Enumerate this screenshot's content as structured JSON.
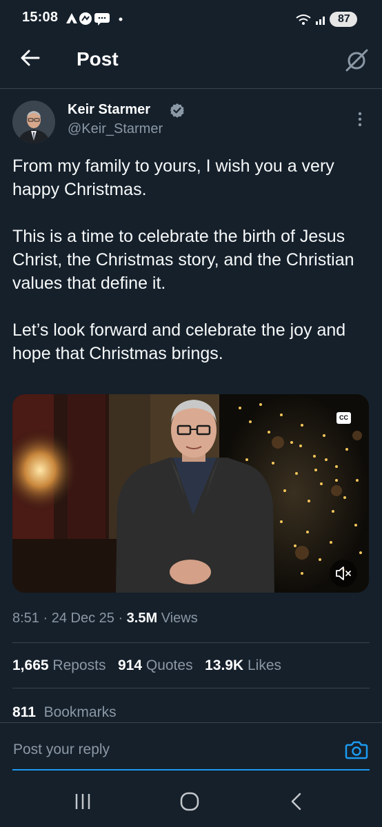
{
  "status_bar": {
    "time": "15:08",
    "battery": "87"
  },
  "header": {
    "title": "Post"
  },
  "author": {
    "name": "Keir Starmer",
    "handle": "@Keir_Starmer"
  },
  "tweet": {
    "paragraphs": [
      "From my family to yours, I wish you a very happy Christmas.",
      "This is a time to celebrate the birth of Jesus Christ, the Christmas story, and the Christian values that define it.",
      "Let’s look forward and celebrate the joy and hope that Christmas brings."
    ]
  },
  "media": {
    "cc_label": "CC"
  },
  "meta": {
    "time": "8:51",
    "sep": " · ",
    "date": "24 Dec 25",
    "views_count": "3.5M",
    "views_label": "Views"
  },
  "stats": {
    "reposts_count": "1,665",
    "reposts_label": "Reposts",
    "quotes_count": "914",
    "quotes_label": "Quotes",
    "likes_count": "13.9K",
    "likes_label": "Likes",
    "bookmarks_count": "811",
    "bookmarks_label": "Bookmarks"
  },
  "reply": {
    "placeholder": "Post your reply"
  },
  "colors": {
    "background": "#15202b",
    "accent": "#1d9bf0",
    "muted": "#8b98a5"
  }
}
